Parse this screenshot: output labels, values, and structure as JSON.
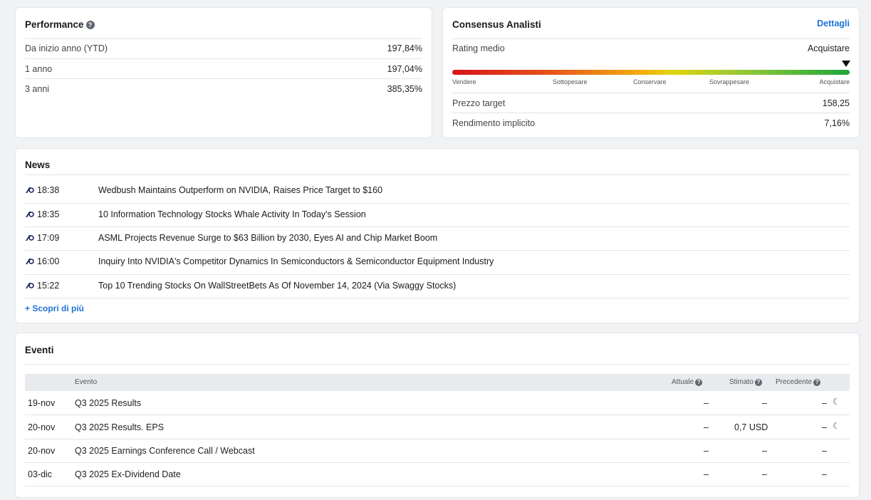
{
  "performance": {
    "title": "Performance",
    "help_icon": "question-circle-icon",
    "rows": [
      {
        "label": "Da inizio anno (YTD)",
        "value": "197,84%"
      },
      {
        "label": "1 anno",
        "value": "197,04%"
      },
      {
        "label": "3 anni",
        "value": "385,35%"
      }
    ]
  },
  "consensus": {
    "title": "Consensus Analisti",
    "details_link": "Dettagli",
    "rating_label": "Rating medio",
    "rating_value": "Acquistare",
    "gauge_level": 1.0,
    "gauge_colors": [
      "#d6131d",
      "#f0b010",
      "#1ea53c"
    ],
    "scale": [
      "Vendere",
      "Sottopesare",
      "Conservare",
      "Sovrappesare",
      "Acquistare"
    ],
    "rows": [
      {
        "label": "Prezzo target",
        "value": "158,25"
      },
      {
        "label": "Rendimento implicito",
        "value": "7,16%"
      }
    ]
  },
  "news": {
    "title": "News",
    "source_icon": "news-source-logo-icon",
    "items": [
      {
        "time": "18:38",
        "title": "Wedbush Maintains Outperform on NVIDIA, Raises Price Target to $160"
      },
      {
        "time": "18:35",
        "title": "10 Information Technology Stocks Whale Activity In Today's Session"
      },
      {
        "time": "17:09",
        "title": "ASML Projects Revenue Surge to $63 Billion by 2030, Eyes AI and Chip Market Boom"
      },
      {
        "time": "16:00",
        "title": "Inquiry Into NVIDIA's Competitor Dynamics In Semiconductors & Semiconductor Equipment Industry"
      },
      {
        "time": "15:22",
        "title": "Top 10 Trending Stocks On WallStreetBets As Of November 14, 2024 (Via Swaggy Stocks)"
      }
    ],
    "more_link": "+ Scopri di più"
  },
  "events": {
    "title": "Eventi",
    "columns": {
      "event": "Evento",
      "actual": "Attuale",
      "estimate": "Stimato",
      "previous": "Precedente"
    },
    "rows": [
      {
        "date": "19-nov",
        "event": "Q3 2025 Results",
        "actual": "–",
        "estimate": "–",
        "previous": "–",
        "after_close_icon": "moon-icon"
      },
      {
        "date": "20-nov",
        "event": "Q3 2025 Results. EPS",
        "actual": "–",
        "estimate": "0,7 USD",
        "previous": "–",
        "after_close_icon": "moon-icon"
      },
      {
        "date": "20-nov",
        "event": "Q3 2025 Earnings Conference Call / Webcast",
        "actual": "–",
        "estimate": "–",
        "previous": "–"
      },
      {
        "date": "03-dic",
        "event": "Q3 2025 Ex-Dividend Date",
        "actual": "–",
        "estimate": "–",
        "previous": "–"
      }
    ]
  }
}
